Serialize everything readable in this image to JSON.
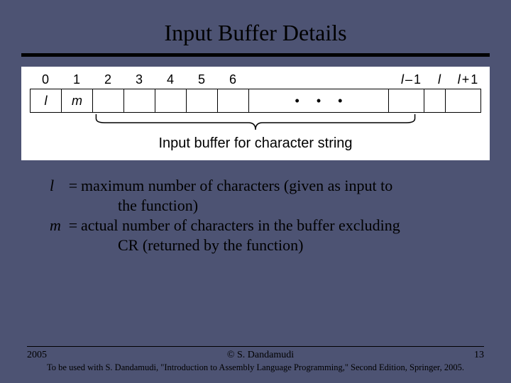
{
  "title": "Input Buffer Details",
  "figure": {
    "indices": [
      "0",
      "1",
      "2",
      "3",
      "4",
      "5",
      "6"
    ],
    "indices_right": [
      {
        "var": "l",
        "op": "–",
        "num": "1"
      },
      {
        "var": "l",
        "op": "",
        "num": ""
      },
      {
        "var": "l",
        "op": "+",
        "num": "1"
      }
    ],
    "cells": [
      "l",
      "m",
      "",
      "",
      "",
      "",
      ""
    ],
    "dots": [
      "•",
      "•",
      "•"
    ],
    "caption": "Input buffer for character string"
  },
  "defs": {
    "l_sym": "l",
    "l_eq": "=",
    "l_text1": "maximum number of characters (given as input to",
    "l_text2": "the function)",
    "m_sym": "m",
    "m_eq": "=",
    "m_text1": "actual number of characters in the buffer excluding",
    "m_text2": "CR (returned by the function)"
  },
  "footer": {
    "year": "2005",
    "copy": "© S. Dandamudi",
    "page": "13",
    "sub": "To be used with S. Dandamudi, \"Introduction to Assembly Language Programming,\" Second Edition, Springer, 2005."
  }
}
